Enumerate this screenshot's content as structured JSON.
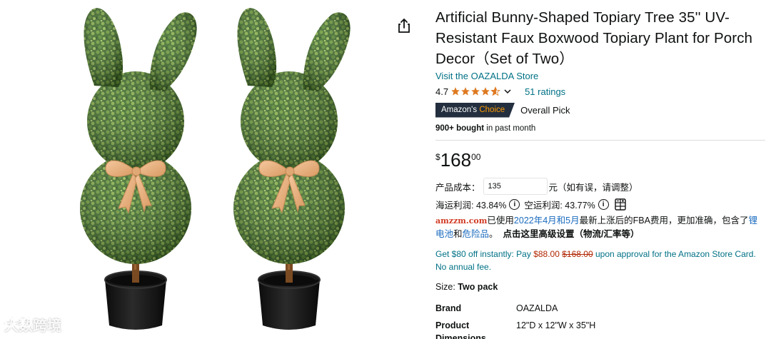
{
  "product": {
    "title": "Artificial Bunny-Shaped Topiary Tree 35'' UV-Resistant Faux Boxwood Topiary Plant for Porch Decor（Set of Two）",
    "store_link": "Visit the OAZALDA Store",
    "rating": "4.7",
    "stars_filled": 4.7,
    "ratings_count": "51 ratings",
    "badge_prefix": "Amazon's",
    "badge_word": "Choice",
    "badge_label": "Overall Pick",
    "bought_bold": "900+ bought",
    "bought_rest": " in past month"
  },
  "price": {
    "symbol": "$",
    "whole": "168",
    "fraction": "00"
  },
  "plugin": {
    "cost_label": "产品成本：",
    "cost_value": "135",
    "cost_suffix": "元（如有误，请调整）",
    "sea_profit_label": "海运利润: 43.84%",
    "air_profit_label": "空运利润: 43.77%",
    "info_glyph": "i",
    "brand": "amzzm.com",
    "note_1": "已使用",
    "note_2": "2022年4月和5月",
    "note_3": "最新上涨后的FBA费用，更加准确，包含了",
    "note_4": "锂电池",
    "note_5": "和",
    "note_6": "危险品",
    "note_7": "。",
    "note_bold": "点击这里高级设置（物流/汇率等）"
  },
  "card_offer": {
    "part1": "Get $80 off instantly: Pay ",
    "pay_price": "$88.00",
    "old_price": "$168.00",
    "part2": " upon approval for the Amazon Store Card. No annual fee."
  },
  "size": {
    "label": "Size: ",
    "value": "Two pack"
  },
  "specs": [
    {
      "label": "Brand",
      "value": "OAZALDA"
    },
    {
      "label": "Product Dimensions",
      "value": "12\"D x 12\"W x 35\"H"
    }
  ],
  "watermark": {
    "text": "大数跨境"
  },
  "icons": {
    "share": "share-icon",
    "star": "star-icon",
    "chevron": "chevron-down-icon",
    "info": "info-icon",
    "calculator": "calculator-icon"
  },
  "colors": {
    "link": "#007185",
    "star": "#de7921",
    "badge_bg": "#232f3e",
    "badge_accent": "#ff9900",
    "price_red": "#b12704",
    "brand_red": "#d13b24",
    "plugin_blue": "#1a6bbf"
  }
}
